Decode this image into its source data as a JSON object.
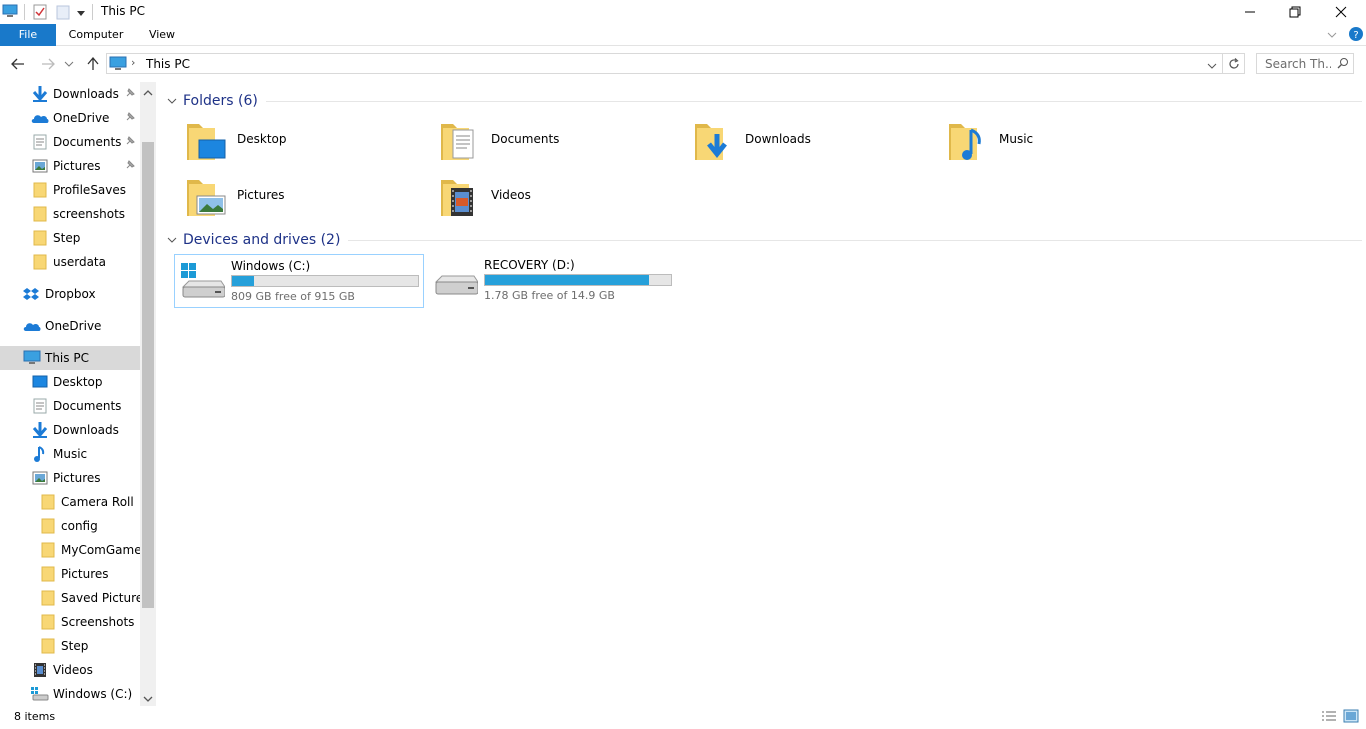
{
  "window": {
    "title": "This PC"
  },
  "ribbon": {
    "tabs": [
      "File",
      "Computer",
      "View"
    ]
  },
  "address": {
    "crumb": "This PC"
  },
  "search": {
    "placeholder": "Search Th..."
  },
  "nav": {
    "items": [
      {
        "label": "Downloads",
        "icon": "downloads-icon",
        "pinned": true
      },
      {
        "label": "OneDrive",
        "icon": "onedrive-icon",
        "pinned": true
      },
      {
        "label": "Documents",
        "icon": "documents-icon",
        "pinned": true
      },
      {
        "label": "Pictures",
        "icon": "pictures-icon",
        "pinned": true
      },
      {
        "label": "ProfileSaves",
        "icon": "folder-icon"
      },
      {
        "label": "screenshots",
        "icon": "folder-icon"
      },
      {
        "label": "Step",
        "icon": "folder-icon"
      },
      {
        "label": "userdata",
        "icon": "folder-icon"
      },
      {
        "label": "Dropbox",
        "icon": "dropbox-icon"
      },
      {
        "label": "OneDrive",
        "icon": "onedrive-icon"
      },
      {
        "label": "This PC",
        "icon": "computer-icon",
        "selected": true
      },
      {
        "label": "Desktop",
        "icon": "desktop-icon"
      },
      {
        "label": "Documents",
        "icon": "documents-icon"
      },
      {
        "label": "Downloads",
        "icon": "downloads-icon"
      },
      {
        "label": "Music",
        "icon": "music-icon"
      },
      {
        "label": "Pictures",
        "icon": "pictures-icon"
      },
      {
        "label": "Camera Roll",
        "icon": "folder-icon"
      },
      {
        "label": "config",
        "icon": "folder-icon"
      },
      {
        "label": "MyComGameC",
        "icon": "folder-icon"
      },
      {
        "label": "Pictures",
        "icon": "folder-icon"
      },
      {
        "label": "Saved Pictures",
        "icon": "folder-icon"
      },
      {
        "label": "Screenshots",
        "icon": "folder-icon"
      },
      {
        "label": "Step",
        "icon": "folder-icon"
      },
      {
        "label": "Videos",
        "icon": "videos-icon"
      },
      {
        "label": "Windows (C:)",
        "icon": "drive-icon"
      }
    ]
  },
  "groups": {
    "folders": {
      "header": "Folders (6)",
      "items": [
        {
          "label": "Desktop",
          "icon": "desktop-folder-icon"
        },
        {
          "label": "Documents",
          "icon": "documents-folder-icon"
        },
        {
          "label": "Downloads",
          "icon": "downloads-folder-icon"
        },
        {
          "label": "Music",
          "icon": "music-folder-icon"
        },
        {
          "label": "Pictures",
          "icon": "pictures-folder-icon"
        },
        {
          "label": "Videos",
          "icon": "videos-folder-icon"
        }
      ]
    },
    "drives": {
      "header": "Devices and drives (2)",
      "items": [
        {
          "name": "Windows (C:)",
          "free": "809 GB free of 915 GB",
          "used_fraction": 0.116,
          "icon": "windows-drive-icon"
        },
        {
          "name": "RECOVERY (D:)",
          "free": "1.78 GB free of 14.9 GB",
          "used_fraction": 0.88,
          "icon": "drive-icon"
        }
      ]
    }
  },
  "status": {
    "count": "8 items"
  },
  "colors": {
    "accent": "#1979ca",
    "bar_fill": "#26a0da",
    "group_header": "#1e3287",
    "folder": "#f8d775"
  }
}
